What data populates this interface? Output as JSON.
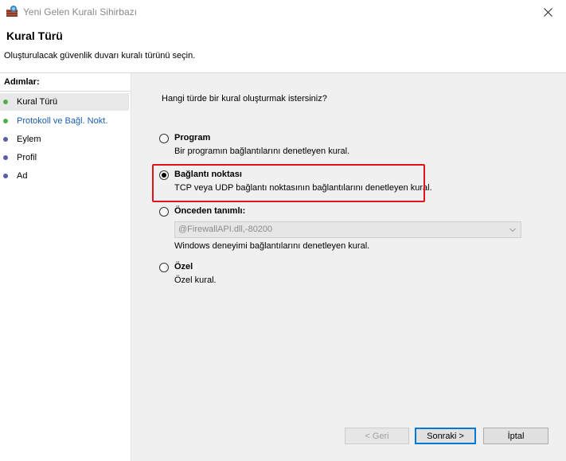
{
  "window": {
    "title": "Yeni Gelen Kuralı Sihirbazı",
    "icon": "firewall-wizard-icon"
  },
  "header": {
    "title": "Kural Türü",
    "subtitle": "Oluşturulacak güvenlik duvarı kuralı türünü seçin."
  },
  "sidebar": {
    "title": "Adımlar:",
    "steps": [
      {
        "label": "Kural Türü",
        "state": "current",
        "dot_color": "#4caf50"
      },
      {
        "label": "Protokoll ve Bağl. Nokt.",
        "state": "done",
        "dot_color": "#4caf50"
      },
      {
        "label": "Eylem",
        "state": "pending",
        "dot_color": "#5b5ea6"
      },
      {
        "label": "Profil",
        "state": "pending",
        "dot_color": "#5b5ea6"
      },
      {
        "label": "Ad",
        "state": "pending",
        "dot_color": "#5b5ea6"
      }
    ]
  },
  "main": {
    "question": "Hangi türde bir kural oluşturmak istersiniz?",
    "options": [
      {
        "label": "Program",
        "description": "Bir programın bağlantılarını denetleyen kural.",
        "checked": false
      },
      {
        "label": "Bağlantı noktası",
        "description": "TCP veya UDP bağlantı noktasının bağlantılarını denetleyen kural.",
        "checked": true
      },
      {
        "label": "Önceden tanımlı:",
        "description": "Windows deneyimi bağlantılarını denetleyen kural.",
        "checked": false
      },
      {
        "label": "Özel",
        "description": "Özel kural.",
        "checked": false
      }
    ],
    "predefined_select": {
      "value": "@FirewallAPI.dll,-80200",
      "disabled": true
    }
  },
  "buttons": {
    "back": "< Geri",
    "next": "Sonraki >",
    "cancel": "İptal"
  },
  "colors": {
    "highlight": "#e0141b",
    "accent": "#0078d7"
  }
}
